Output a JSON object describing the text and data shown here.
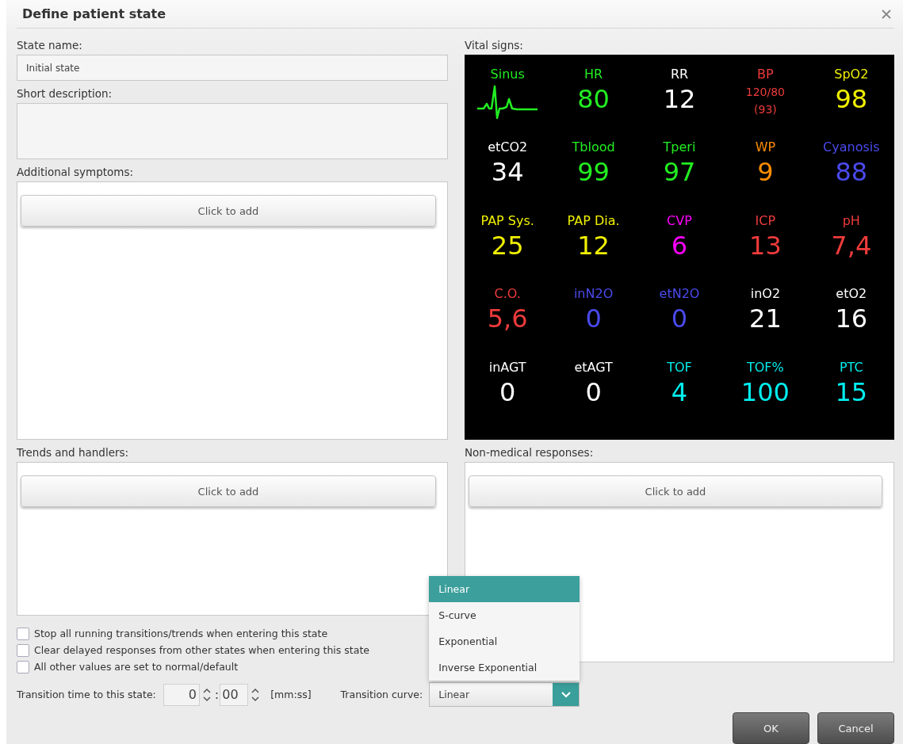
{
  "window": {
    "title": "Define patient state"
  },
  "state_name": {
    "label": "State name:",
    "value": "Initial state"
  },
  "short_description": {
    "label": "Short description:"
  },
  "additional_symptoms": {
    "label": "Additional symptoms:",
    "button": "Click to add"
  },
  "trends_and_handlers": {
    "label": "Trends and handlers:",
    "button": "Click to add"
  },
  "vital_signs": {
    "label": "Vital signs:",
    "items": [
      {
        "kind": "waveform",
        "label": "Sinus",
        "color": "#22ee22"
      },
      {
        "kind": "number",
        "label": "HR",
        "value": "80",
        "color": "#22ee22"
      },
      {
        "kind": "number",
        "label": "RR",
        "value": "12",
        "color": "#ffffff"
      },
      {
        "kind": "pressure",
        "label": "BP",
        "value": "120/80",
        "mean": "(93)",
        "color": "#ee3b3b"
      },
      {
        "kind": "number",
        "label": "SpO2",
        "value": "98",
        "color": "#f0f000"
      },
      {
        "kind": "number",
        "label": "etCO2",
        "value": "34",
        "color": "#ffffff"
      },
      {
        "kind": "number",
        "label": "Tblood",
        "value": "99",
        "color": "#22ee22"
      },
      {
        "kind": "number",
        "label": "Tperi",
        "value": "97",
        "color": "#22ee22"
      },
      {
        "kind": "number",
        "label": "WP",
        "value": "9",
        "color": "#ff8c00"
      },
      {
        "kind": "number",
        "label": "Cyanosis",
        "value": "88",
        "color": "#4a4aee"
      },
      {
        "kind": "number",
        "label": "PAP Sys.",
        "value": "25",
        "color": "#f0f000"
      },
      {
        "kind": "number",
        "label": "PAP Dia.",
        "value": "12",
        "color": "#f0f000"
      },
      {
        "kind": "number",
        "label": "CVP",
        "value": "6",
        "color": "#ff00ff"
      },
      {
        "kind": "number",
        "label": "ICP",
        "value": "13",
        "color": "#ee3b3b"
      },
      {
        "kind": "number",
        "label": "pH",
        "value": "7,4",
        "color": "#ee3b3b"
      },
      {
        "kind": "number",
        "label": "C.O.",
        "value": "5,6",
        "color": "#ee3b3b"
      },
      {
        "kind": "number",
        "label": "inN2O",
        "value": "0",
        "color": "#4a4aee"
      },
      {
        "kind": "number",
        "label": "etN2O",
        "value": "0",
        "color": "#4a4aee"
      },
      {
        "kind": "number",
        "label": "inO2",
        "value": "21",
        "color": "#ffffff"
      },
      {
        "kind": "number",
        "label": "etO2",
        "value": "16",
        "color": "#ffffff"
      },
      {
        "kind": "number",
        "label": "inAGT",
        "value": "0",
        "color": "#ffffff"
      },
      {
        "kind": "number",
        "label": "etAGT",
        "value": "0",
        "color": "#ffffff"
      },
      {
        "kind": "number",
        "label": "TOF",
        "value": "4",
        "color": "#00eeee"
      },
      {
        "kind": "number",
        "label": "TOF%",
        "value": "100",
        "color": "#00eeee"
      },
      {
        "kind": "number",
        "label": "PTC",
        "value": "15",
        "color": "#00eeee"
      }
    ]
  },
  "non_medical_responses": {
    "label": "Non-medical responses:",
    "button": "Click to add"
  },
  "options": [
    {
      "label": "Stop all running transitions/trends when entering this state",
      "checked": false
    },
    {
      "label": "Clear delayed responses from other states when entering this state",
      "checked": false
    },
    {
      "label": "All other values are set to normal/default",
      "checked": false
    }
  ],
  "transition_time": {
    "label": "Transition time to this state:",
    "minutes": "0",
    "separator": ":",
    "seconds": "00",
    "unit": "[mm:ss]"
  },
  "transition_curve": {
    "label": "Transition curve:",
    "value": "Linear",
    "expanded": true,
    "options": [
      {
        "label": "Linear",
        "selected": true
      },
      {
        "label": "S-curve",
        "selected": false
      },
      {
        "label": "Exponential",
        "selected": false
      },
      {
        "label": "Inverse Exponential",
        "selected": false
      }
    ]
  },
  "buttons": [
    "OK",
    "Cancel"
  ]
}
